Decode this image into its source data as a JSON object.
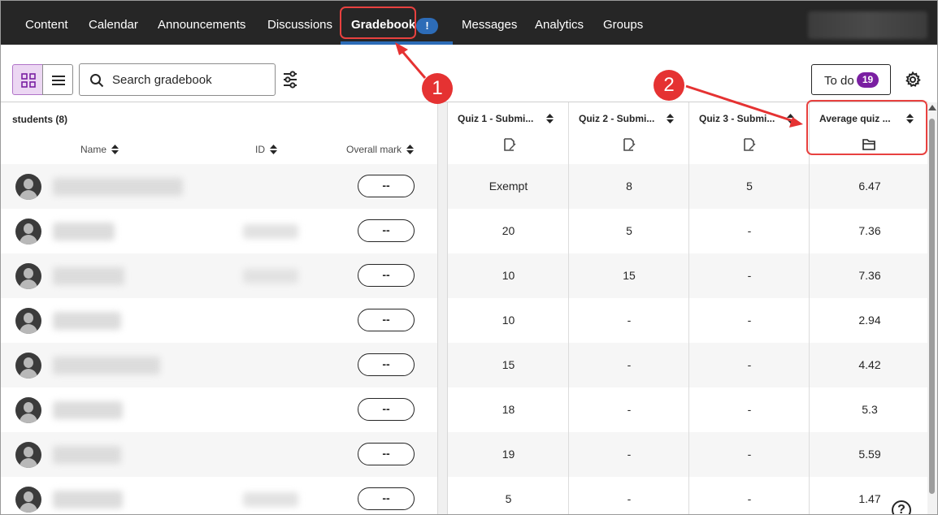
{
  "nav": {
    "items": [
      {
        "label": "Content"
      },
      {
        "label": "Calendar"
      },
      {
        "label": "Announcements"
      },
      {
        "label": "Discussions"
      },
      {
        "label": "Gradebook",
        "active": true
      },
      {
        "label": "Messages"
      },
      {
        "label": "Analytics"
      },
      {
        "label": "Groups"
      }
    ],
    "gradebook_badge": "!"
  },
  "toolbar": {
    "search_placeholder": "Search gradebook",
    "todo_label": "To do",
    "todo_count": "19"
  },
  "students": {
    "title": "students (8)",
    "col_name": "Name",
    "col_id": "ID",
    "col_overall": "Overall mark"
  },
  "grade_columns": [
    {
      "title": "Quiz 1 - Submi...",
      "icon": "assignment-edit-icon"
    },
    {
      "title": "Quiz 2 - Submi...",
      "icon": "assignment-edit-icon"
    },
    {
      "title": "Quiz 3 - Submi...",
      "icon": "assignment-edit-icon"
    },
    {
      "title": "Average quiz ...",
      "icon": "folder-icon"
    }
  ],
  "rows": [
    {
      "overall": "--",
      "q1": "Exempt",
      "q2": "8",
      "q3": "5",
      "avg": "6.47"
    },
    {
      "overall": "--",
      "q1": "20",
      "q2": "5",
      "q3": "-",
      "avg": "7.36"
    },
    {
      "overall": "--",
      "q1": "10",
      "q2": "15",
      "q3": "-",
      "avg": "7.36"
    },
    {
      "overall": "--",
      "q1": "10",
      "q2": "-",
      "q3": "-",
      "avg": "2.94"
    },
    {
      "overall": "--",
      "q1": "15",
      "q2": "-",
      "q3": "-",
      "avg": "4.42"
    },
    {
      "overall": "--",
      "q1": "18",
      "q2": "-",
      "q3": "-",
      "avg": "5.3"
    },
    {
      "overall": "--",
      "q1": "19",
      "q2": "-",
      "q3": "-",
      "avg": "5.59"
    },
    {
      "overall": "--",
      "q1": "5",
      "q2": "-",
      "q3": "-",
      "avg": "1.47"
    }
  ],
  "annotations": {
    "callout_1": "1",
    "callout_2": "2",
    "color": "#e53232"
  },
  "help_label": "?",
  "colors": {
    "nav_bg": "#262626",
    "accent_blue": "#2d6cb7",
    "todo_badge": "#7a1fa2",
    "view_active_bg": "#ecd7f3"
  }
}
